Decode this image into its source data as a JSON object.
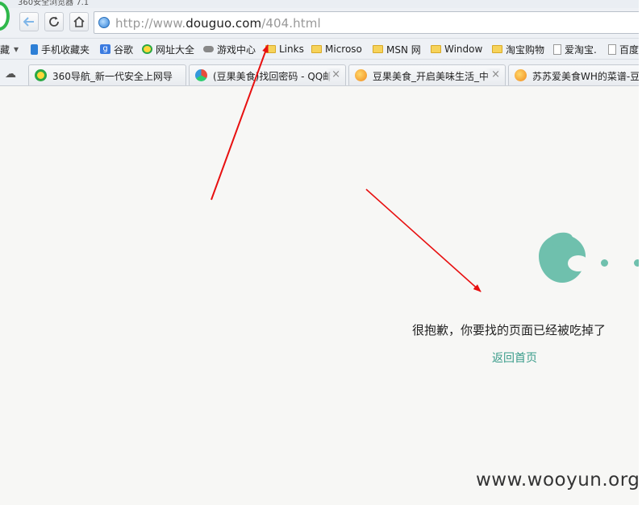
{
  "window": {
    "title": "360安全浏览器 7.1"
  },
  "address_bar": {
    "url_prefix": "http://www.",
    "url_host": "douguo.com",
    "url_path": "/404.html"
  },
  "bookmarks": {
    "partial_first": "藏",
    "items": [
      {
        "label": "手机收藏夹",
        "icon": "phone-icon"
      },
      {
        "label": "谷歌",
        "icon": "google-icon"
      },
      {
        "label": "网址大全",
        "icon": "360-nav-icon"
      },
      {
        "label": "游戏中心",
        "icon": "gamepad-icon"
      },
      {
        "label": "Links",
        "icon": "folder-icon"
      },
      {
        "label": "Microso",
        "icon": "folder-icon"
      },
      {
        "label": "MSN 网",
        "icon": "folder-icon"
      },
      {
        "label": "Window",
        "icon": "folder-icon"
      },
      {
        "label": "淘宝购物",
        "icon": "folder-icon"
      },
      {
        "label": "爱淘宝.",
        "icon": "page-icon"
      },
      {
        "label": "百度",
        "icon": "page-icon"
      }
    ]
  },
  "tabs": [
    {
      "title": "360导航_新一代安全上网导",
      "icon": "360-icon"
    },
    {
      "title": "(豆果美食)找回密码 - QQ邮",
      "icon": "qq-mail-icon"
    },
    {
      "title": "豆果美食_开启美味生活_中",
      "icon": "douguo-icon"
    },
    {
      "title": "苏苏爱美食WH的菜谱-豆",
      "icon": "douguo-icon"
    }
  ],
  "page": {
    "message": "很抱歉，你要找的页面已经被吃掉了",
    "back_link": "返回首页",
    "watermark": "www.wooyun.org"
  },
  "colors": {
    "accent_teal": "#6fc0ad",
    "link_teal": "#3a9c8a",
    "arrow_red": "#e81010"
  }
}
